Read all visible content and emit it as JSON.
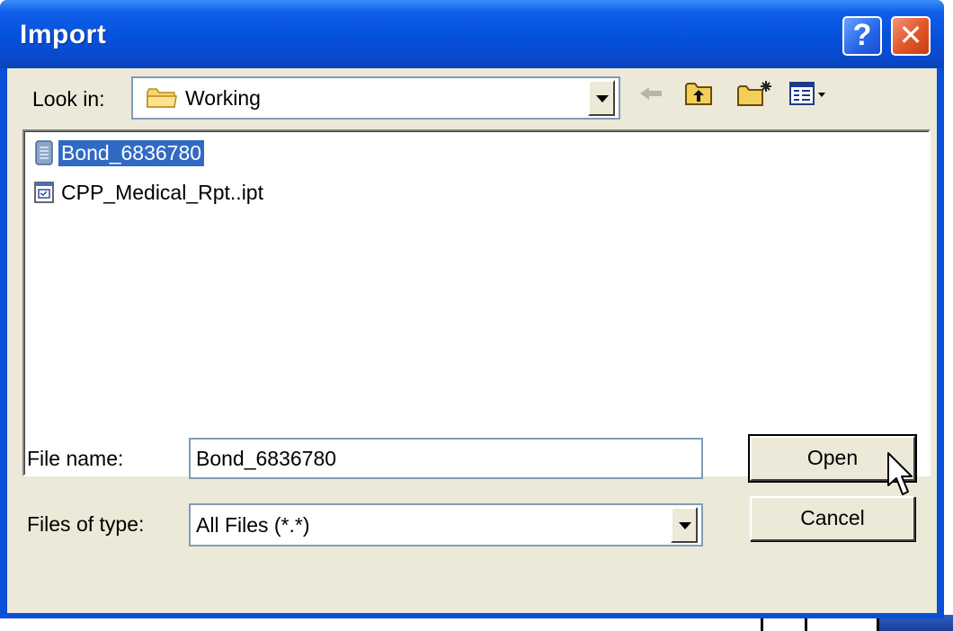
{
  "window": {
    "title": "Import",
    "help_label": "?",
    "close_label": "✕"
  },
  "lookin": {
    "label": "Look in:",
    "value": "Working",
    "folder_icon": "folder-icon"
  },
  "toolbar": {
    "back_icon": "back-arrow-icon",
    "up_icon": "up-folder-icon",
    "new_folder_icon": "new-folder-icon",
    "view_menu_icon": "view-menu-icon"
  },
  "files": [
    {
      "name": "Bond_6836780",
      "icon": "document-icon",
      "selected": true
    },
    {
      "name": "CPP_Medical_Rpt..ipt",
      "icon": "script-file-icon",
      "selected": false
    }
  ],
  "filename": {
    "label": "File name:",
    "value": "Bond_6836780"
  },
  "filetype": {
    "label": "Files of type:",
    "value": "All Files (*.*)"
  },
  "buttons": {
    "open": "Open",
    "cancel": "Cancel"
  },
  "colors": {
    "titlebar": "#0651dc",
    "client_bg": "#ece9d8",
    "selection": "#316ac5",
    "close_button": "#e25526"
  }
}
